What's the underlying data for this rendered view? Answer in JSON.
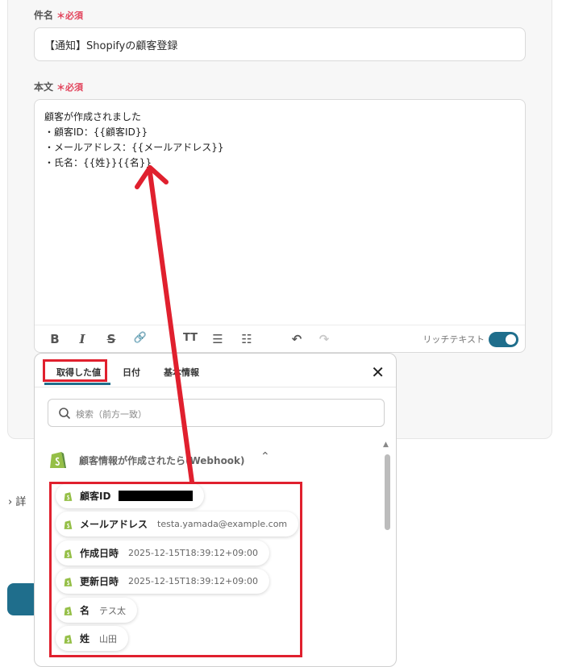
{
  "subject": {
    "label": "件名",
    "required": "＊必須",
    "value": "【通知】Shopifyの顧客登録"
  },
  "body": {
    "label": "本文",
    "required": "＊必須",
    "lines": [
      "顧客が作成されました",
      "・顧客ID：{{顧客ID}}",
      "・メールアドレス：{{メールアドレス}}",
      "・氏名：{{姓}}{{名}}"
    ],
    "rich_text_label": "リッチテキスト",
    "rich_text_on": true,
    "toolbar": [
      "B",
      "I",
      "S",
      "🔗",
      "TT",
      "☰",
      "☷",
      "↶",
      "↷"
    ]
  },
  "details": "詳",
  "popup": {
    "tabs": [
      "取得した値",
      "日付",
      "基本情報"
    ],
    "active_tab": "取得した値",
    "search_placeholder": "検索（前方一致）",
    "group_title": "顧客情報が作成されたら(Webhook)",
    "items": [
      {
        "key": "顧客ID",
        "value": "",
        "redacted": true
      },
      {
        "key": "メールアドレス",
        "value": "testa.yamada@example.com"
      },
      {
        "key": "作成日時",
        "value": "2025-12-15T18:39:12+09:00"
      },
      {
        "key": "更新日時",
        "value": "2025-12-15T18:39:12+09:00"
      },
      {
        "key": "名",
        "value": "テス太"
      },
      {
        "key": "姓",
        "value": "山田"
      }
    ]
  },
  "colors": {
    "accent": "#1f6e8c",
    "required": "#e2445c",
    "highlight": "#e0202e",
    "shopify": "#95bf47"
  },
  "icons": {
    "close": "close-icon",
    "search": "search-icon",
    "shopify": "shopify-icon",
    "chevron": "chevron-up-icon"
  }
}
